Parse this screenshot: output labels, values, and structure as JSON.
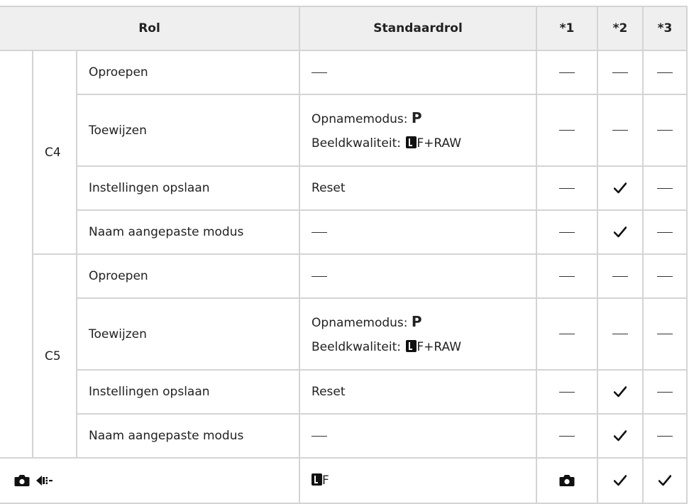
{
  "header": {
    "col_role": "Rol",
    "col_default": "Standaardrol",
    "col_1": "*1",
    "col_2": "*2",
    "col_3": "*3"
  },
  "groups": [
    {
      "label": "C4",
      "rows": [
        {
          "role": "Oproepen",
          "default": "—",
          "c1": "dash",
          "c2": "dash",
          "c3": "dash"
        },
        {
          "role": "Toewijzen",
          "default_line1_label": "Opnamemodus:",
          "default_line1_value": "P",
          "default_line2_label": "Beeldkwaliteit:",
          "default_line2_value": "F+RAW",
          "c1": "dash",
          "c2": "dash",
          "c3": "dash"
        },
        {
          "role": "Instellingen opslaan",
          "default": "Reset",
          "c1": "dash",
          "c2": "check",
          "c3": "dash"
        },
        {
          "role": "Naam aangepaste modus",
          "default": "—",
          "c1": "dash",
          "c2": "check",
          "c3": "dash"
        }
      ]
    },
    {
      "label": "C5",
      "rows": [
        {
          "role": "Oproepen",
          "default": "—",
          "c1": "dash",
          "c2": "dash",
          "c3": "dash"
        },
        {
          "role": "Toewijzen",
          "default_line1_label": "Opnamemodus:",
          "default_line1_value": "P",
          "default_line2_label": "Beeldkwaliteit:",
          "default_line2_value": "F+RAW",
          "c1": "dash",
          "c2": "dash",
          "c3": "dash"
        },
        {
          "role": "Instellingen opslaan",
          "default": "Reset",
          "c1": "dash",
          "c2": "check",
          "c3": "dash"
        },
        {
          "role": "Naam aangepaste modus",
          "default": "—",
          "c1": "dash",
          "c2": "check",
          "c3": "dash"
        }
      ]
    }
  ],
  "last_row": {
    "icons": [
      "camera-icon",
      "drive-sequential-icon"
    ],
    "default_value": "F",
    "c1": "camera-icon",
    "c2": "check",
    "c3": "check"
  }
}
